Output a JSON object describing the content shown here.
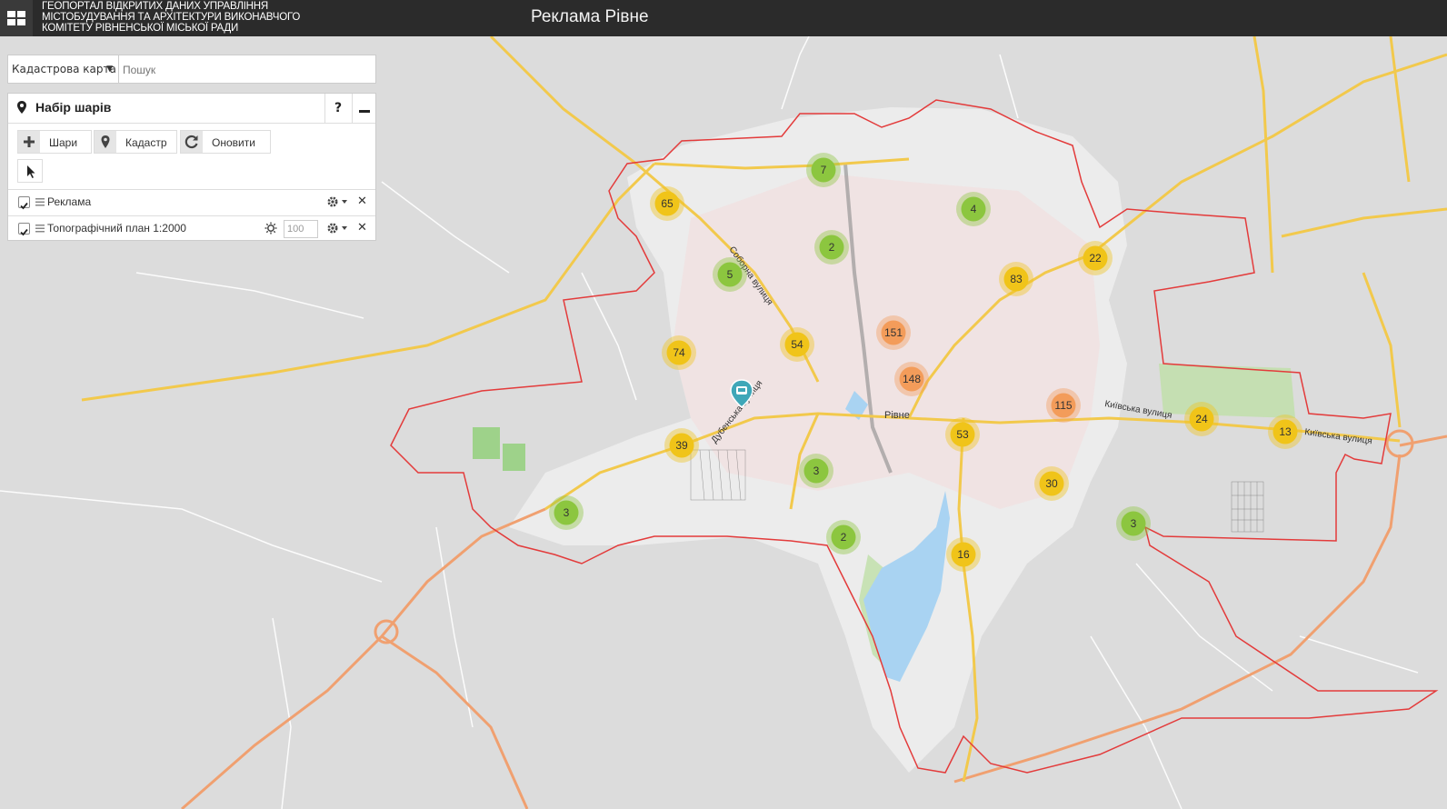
{
  "header": {
    "org_line1": "ГЕОПОРТАЛ ВІДКРИТИХ ДАНИХ УПРАВЛІННЯ",
    "org_line2": "МІСТОБУДУВАННЯ ТА АРХІТЕКТУРИ ВИКОНАВЧОГО",
    "org_line3": "КОМІТЕТУ РІВНЕНСЬКОЇ МІСЬКОЇ РАДИ",
    "title": "Реклама Рівне",
    "menu_icon": "grid-icon"
  },
  "search": {
    "basemap_label": "Кадастрова карта",
    "placeholder": "Пошук"
  },
  "layers_panel": {
    "title": "Набір шарів",
    "help_label": "?",
    "buttons": {
      "layers": "Шари",
      "cadastre": "Кадастр",
      "refresh": "Оновити"
    },
    "layers": [
      {
        "name": "Реклама",
        "checked": true
      },
      {
        "name": "Топографічний план 1:2000",
        "checked": true,
        "opacity": "100"
      }
    ]
  },
  "map": {
    "city_label": "Рівне",
    "streets": [
      "Соборна вулиця",
      "Дубенська вулиця",
      "Київська вулиця",
      "Київська вулиця"
    ],
    "colors": {
      "cluster_green": "#8cc63f",
      "cluster_yellow": "#f0c419",
      "cluster_orange": "#f39c5a",
      "boundary": "#e33b3b",
      "road": "#f2c94c",
      "highway": "#f0a070",
      "water": "#a9d3f2"
    },
    "clusters": [
      {
        "count": "7",
        "level": "green"
      },
      {
        "count": "65",
        "level": "yellow"
      },
      {
        "count": "4",
        "level": "green"
      },
      {
        "count": "2",
        "level": "green"
      },
      {
        "count": "5",
        "level": "green"
      },
      {
        "count": "83",
        "level": "yellow"
      },
      {
        "count": "22",
        "level": "yellow"
      },
      {
        "count": "151",
        "level": "orange"
      },
      {
        "count": "74",
        "level": "yellow"
      },
      {
        "count": "54",
        "level": "yellow"
      },
      {
        "count": "148",
        "level": "orange"
      },
      {
        "count": "115",
        "level": "orange"
      },
      {
        "count": "24",
        "level": "yellow"
      },
      {
        "count": "13",
        "level": "yellow"
      },
      {
        "count": "53",
        "level": "yellow"
      },
      {
        "count": "39",
        "level": "yellow"
      },
      {
        "count": "3",
        "level": "green"
      },
      {
        "count": "30",
        "level": "yellow"
      },
      {
        "count": "3",
        "level": "green"
      },
      {
        "count": "2",
        "level": "green"
      },
      {
        "count": "16",
        "level": "yellow"
      },
      {
        "count": "3",
        "level": "green"
      }
    ]
  }
}
